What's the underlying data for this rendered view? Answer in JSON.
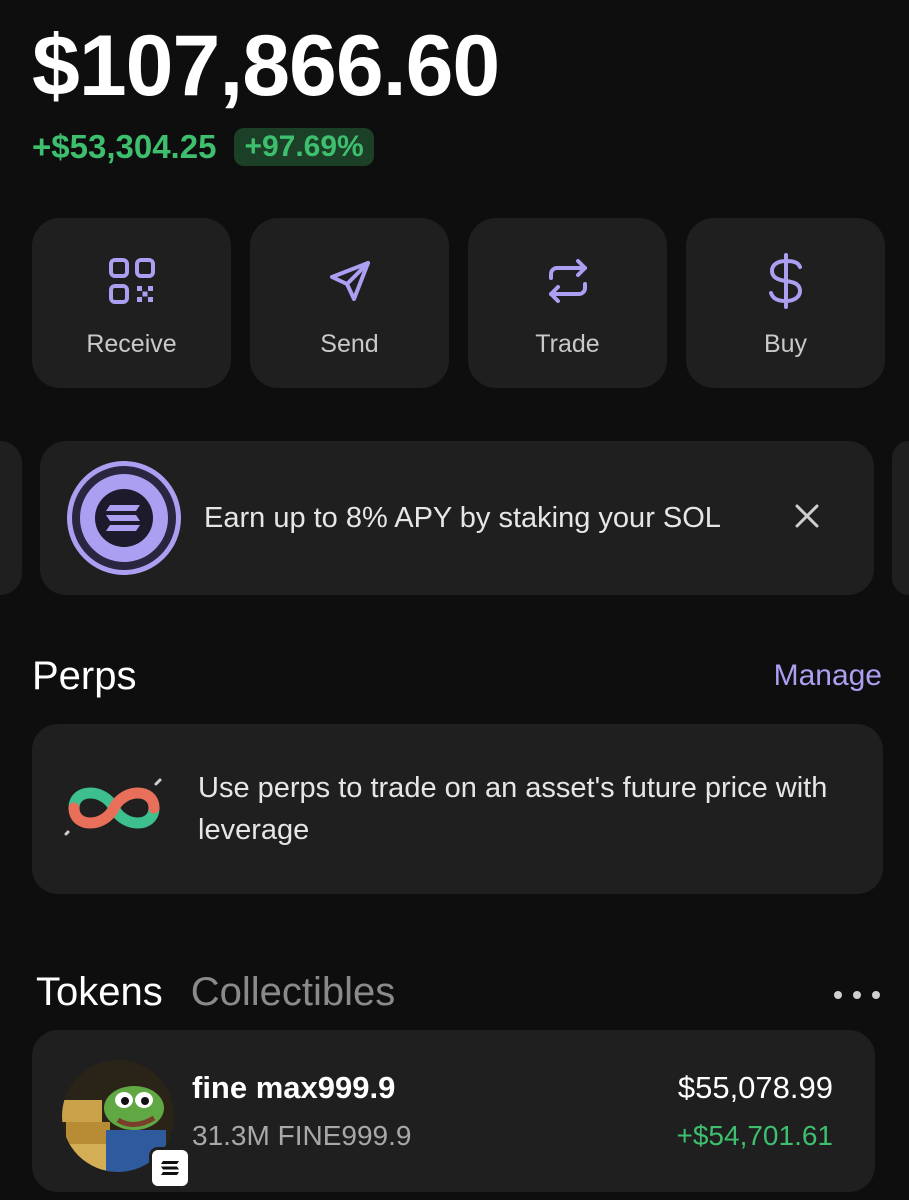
{
  "portfolio": {
    "balance": "$107,866.60",
    "change_amount": "+$53,304.25",
    "change_percent": "+97.69%"
  },
  "actions": [
    {
      "label": "Receive",
      "icon": "qr-code-icon"
    },
    {
      "label": "Send",
      "icon": "send-arrow-icon"
    },
    {
      "label": "Trade",
      "icon": "swap-arrows-icon"
    },
    {
      "label": "Buy",
      "icon": "dollar-icon"
    }
  ],
  "promo": {
    "text": "Earn up to 8% APY by staking your SOL",
    "icon": "solana-icon"
  },
  "perps": {
    "title": "Perps",
    "manage_label": "Manage",
    "description": "Use perps to trade on an asset's future price with leverage",
    "icon": "perps-loop-icon"
  },
  "tabs": {
    "active": "Tokens",
    "inactive": "Collectibles"
  },
  "tokens": [
    {
      "name": "fine max999.9",
      "amount": "31.3M FINE999.9",
      "value": "$55,078.99",
      "change": "+$54,701.61"
    }
  ],
  "colors": {
    "accent": "#ab9ff2",
    "positive": "#3dbf6e",
    "card": "#1f1f1f",
    "background": "#0e0e0e"
  }
}
